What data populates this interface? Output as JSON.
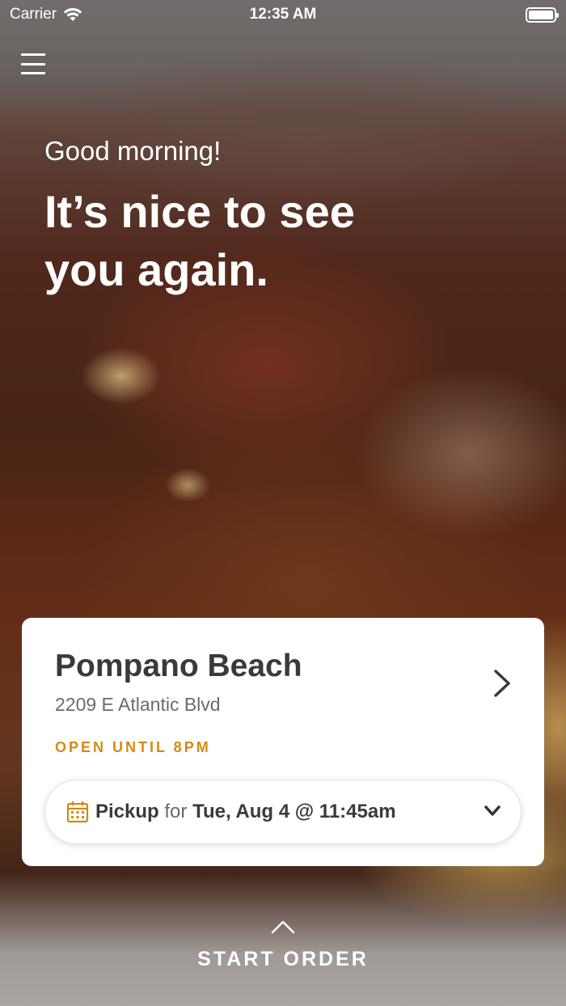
{
  "status_bar": {
    "carrier": "Carrier",
    "time": "12:35 AM"
  },
  "greeting": {
    "small": "Good morning!",
    "big": "It’s nice to see you again."
  },
  "location_card": {
    "name": "Pompano Beach",
    "address": "2209 E Atlantic Blvd",
    "status": "OPEN UNTIL 8PM",
    "order_mode": "Pickup",
    "for_label": "for",
    "time": "Tue, Aug 4 @ 11:45am"
  },
  "start_order": {
    "label": "START ORDER"
  },
  "colors": {
    "accent_orange": "#d48a14",
    "card_background": "#ffffff",
    "text_dark": "#3a3a3a"
  },
  "icons": {
    "menu": "hamburger-menu-icon",
    "wifi": "wifi-icon",
    "battery": "battery-icon",
    "chevron_right": "chevron-right-icon",
    "calendar": "calendar-icon",
    "chevron_down": "chevron-down-icon",
    "chevron_up": "chevron-up-icon"
  }
}
